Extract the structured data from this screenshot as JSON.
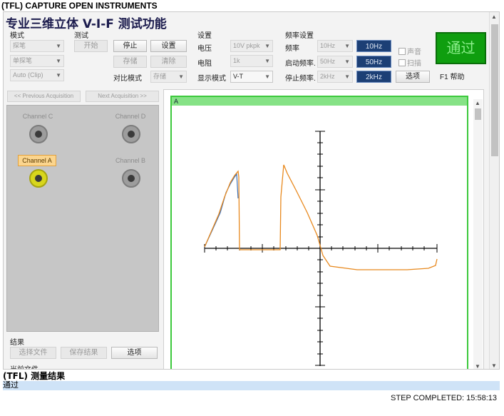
{
  "header": {
    "title": "(TFL) CAPTURE OPEN INSTRUMENTS"
  },
  "app": {
    "title": "专业三维立体 V-I-F 测试功能",
    "groups": {
      "mode": "模式",
      "test": "测试",
      "settings": "设置",
      "freq_settings": "频率设置"
    },
    "mode_selects": [
      "探笔",
      "单探笔",
      "Auto (Clip)"
    ],
    "test_buttons": {
      "start": "开始",
      "stop": "停止",
      "setup": "设置",
      "store": "存储",
      "clear": "清除",
      "compare_mode_label": "对比模式",
      "compare_mode_value": "存储"
    },
    "settings": {
      "voltage_label": "电压",
      "voltage_value": "10V pkpk",
      "resistance_label": "电阻",
      "resistance_value": "1k",
      "display_mode_label": "显示模式",
      "display_mode_value": "V-T"
    },
    "freq": {
      "freq_label": "频率",
      "freq_select": "10Hz",
      "freq_value": "10Hz",
      "start_freq_label": "启动频率.",
      "start_freq_select": "50Hz",
      "start_freq_value": "50Hz",
      "stop_freq_label": "停止频率.",
      "stop_freq_select": "2kHz",
      "stop_freq_value": "2kHz",
      "sound_label": "声音",
      "sweep_label": "扫描",
      "options_button": "选项"
    },
    "pass_indicator": "通过",
    "help_label": "F1 帮助",
    "acquisition": {
      "previous": "<< Previous Acquisition",
      "next": "Next Acquisition >>"
    },
    "channels": {
      "c": "Channel C",
      "d": "Channel D",
      "a": "Channel A",
      "b": "Channel B"
    },
    "results": {
      "label": "结果",
      "select_file": "选择文件",
      "save_result": "保存结果",
      "options": "选项",
      "current_file": "当前文件"
    },
    "scope": {
      "tab_label": "A"
    }
  },
  "status": {
    "title": "(TFL) 测量结果",
    "value": "通过",
    "step_completed": "STEP COMPLETED: 15:58:13"
  },
  "colors": {
    "pass_green": "#0f9e0f",
    "freq_box": "#1c3f75",
    "trace_orange": "#e8891e",
    "trace_blue": "#3c6fb5",
    "status_bar": "#cfe3f7"
  }
}
